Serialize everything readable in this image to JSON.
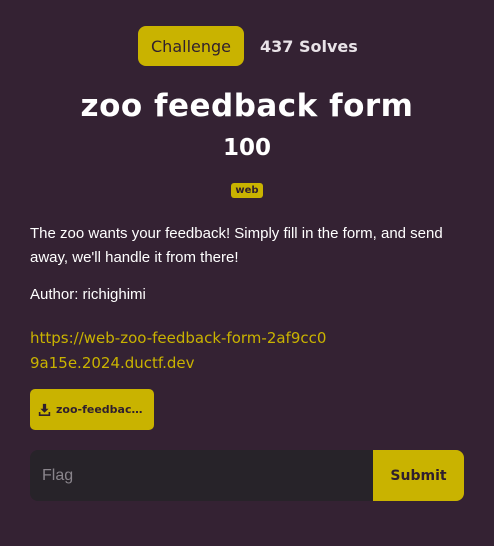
{
  "tabs": {
    "challenge_label": "Challenge",
    "solves_label": "437 Solves"
  },
  "challenge": {
    "title": "zoo feedback form",
    "points": "100",
    "tag": "web",
    "description": "The zoo wants your feedback! Simply fill in the form, and send away, we'll handle it from there!",
    "author": "Author: richighimi",
    "link": "https://web-zoo-feedback-form-2af9cc09a15e.2024.ductf.dev",
    "file_label": "zoo-feedback-form.zip",
    "file_icon": "download-icon"
  },
  "flag_form": {
    "placeholder": "Flag",
    "value": "",
    "submit_label": "Submit"
  },
  "colors": {
    "background": "#342233",
    "accent": "#c9b300",
    "input_bg": "#272329"
  }
}
